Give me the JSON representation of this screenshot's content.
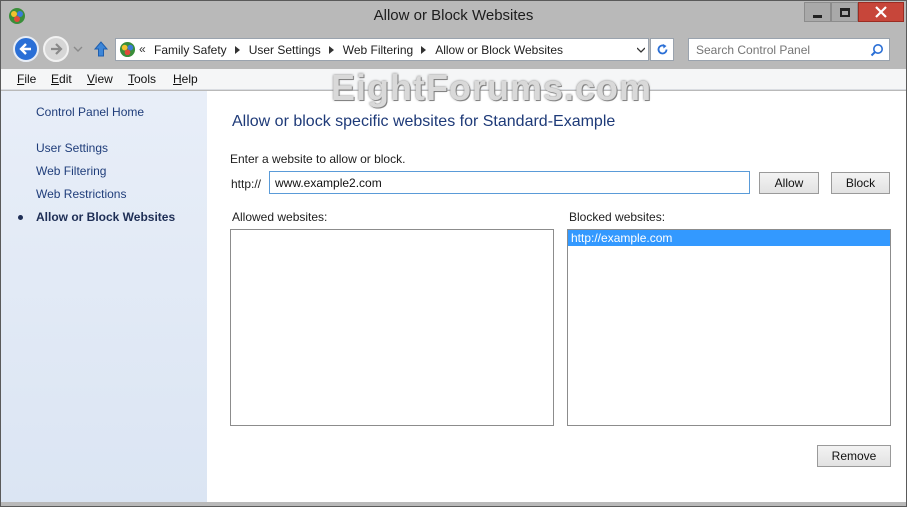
{
  "window": {
    "title": "Allow or Block Websites",
    "accent": "#b9b9b9",
    "close_color": "#c7463a"
  },
  "navigation": {
    "back_icon": "back-arrow-icon",
    "forward_icon": "forward-arrow-icon",
    "up_icon": "up-arrow-icon"
  },
  "address_bar": {
    "overflow": "«",
    "breadcrumbs": [
      "Family Safety",
      "User Settings",
      "Web Filtering",
      "Allow or Block Websites"
    ]
  },
  "search": {
    "placeholder": "Search Control Panel"
  },
  "menu": {
    "items": [
      {
        "key": "F",
        "rest": "ile"
      },
      {
        "key": "E",
        "rest": "dit"
      },
      {
        "key": "V",
        "rest": "iew"
      },
      {
        "key": "T",
        "rest": "ools"
      },
      {
        "key": "H",
        "rest": "elp"
      }
    ]
  },
  "watermark": "EightForums.com",
  "sidebar": {
    "home": "Control Panel Home",
    "links": [
      "User Settings",
      "Web Filtering",
      "Web Restrictions",
      "Allow or Block Websites"
    ]
  },
  "main": {
    "heading": "Allow or block specific websites for Standard-Example",
    "prompt": "Enter a website to allow or block.",
    "prefix": "http://",
    "url_value": "www.example2.com",
    "allow_label": "Allow",
    "block_label": "Block",
    "allowed_label": "Allowed websites:",
    "blocked_label": "Blocked websites:",
    "allowed_sites": [],
    "blocked_sites": [
      "http://example.com"
    ],
    "remove_label": "Remove",
    "selection_color": "#3399ff"
  }
}
